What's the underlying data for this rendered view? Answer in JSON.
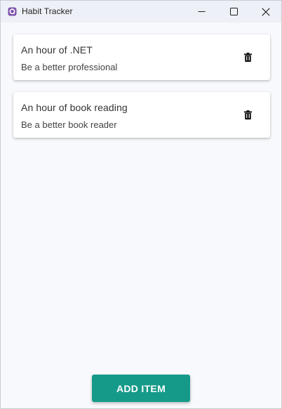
{
  "window": {
    "title": "Habit Tracker",
    "app_icon": "maui-app-icon",
    "controls": [
      "minimize-icon",
      "maximize-icon",
      "close-icon"
    ]
  },
  "habits": [
    {
      "title": "An hour of .NET",
      "subtitle": "Be a better professional",
      "action_icon": "trash-icon"
    },
    {
      "title": "An hour of book reading",
      "subtitle": "Be a better book reader",
      "action_icon": "trash-icon"
    }
  ],
  "footer": {
    "add_label": "ADD ITEM"
  },
  "colors": {
    "accent": "#159a89",
    "card_bg": "#ffffff",
    "page_bg": "#f8f9fc",
    "titlebar_bg": "#edf0f6"
  }
}
